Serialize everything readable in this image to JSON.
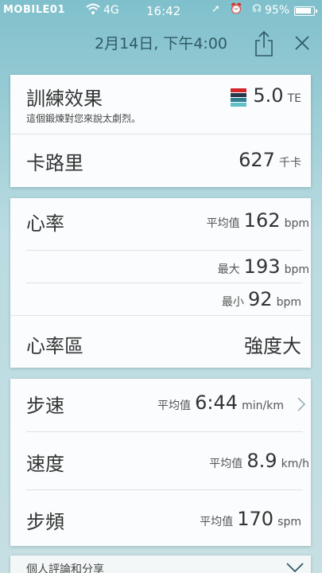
{
  "status_bar": {
    "carrier": "MOBILE01",
    "network": "4G",
    "time": "16:42",
    "icons": "➚ ⏰ ☊",
    "battery": "95%"
  },
  "header": {
    "title": "2月14日, 下午4:00"
  },
  "training_effect": {
    "label": "訓練效果",
    "description": "這個鍛煉對您來說太劇烈。",
    "value": "5.0",
    "unit": "TE",
    "colors": [
      "#d4262a",
      "#28384a",
      "#2f7f8e",
      "#5fc0c8"
    ]
  },
  "calories": {
    "label": "卡路里",
    "value": "627",
    "unit": "千卡"
  },
  "heart_rate": {
    "label": "心率",
    "avg_label": "平均值",
    "avg_value": "162",
    "max_label": "最大",
    "max_value": "193",
    "min_label": "最小",
    "min_value": "92",
    "unit": "bpm"
  },
  "heart_rate_zone": {
    "label": "心率區",
    "value": "強度大"
  },
  "pace": {
    "label": "步速",
    "avg_label": "平均值",
    "value": "6:44",
    "unit": "min/km"
  },
  "speed": {
    "label": "速度",
    "avg_label": "平均值",
    "value": "8.9",
    "unit": "km/h"
  },
  "cadence": {
    "label": "步頻",
    "avg_label": "平均值",
    "value": "170",
    "unit": "spm"
  },
  "bottom": {
    "label": "個人評論和分享"
  }
}
